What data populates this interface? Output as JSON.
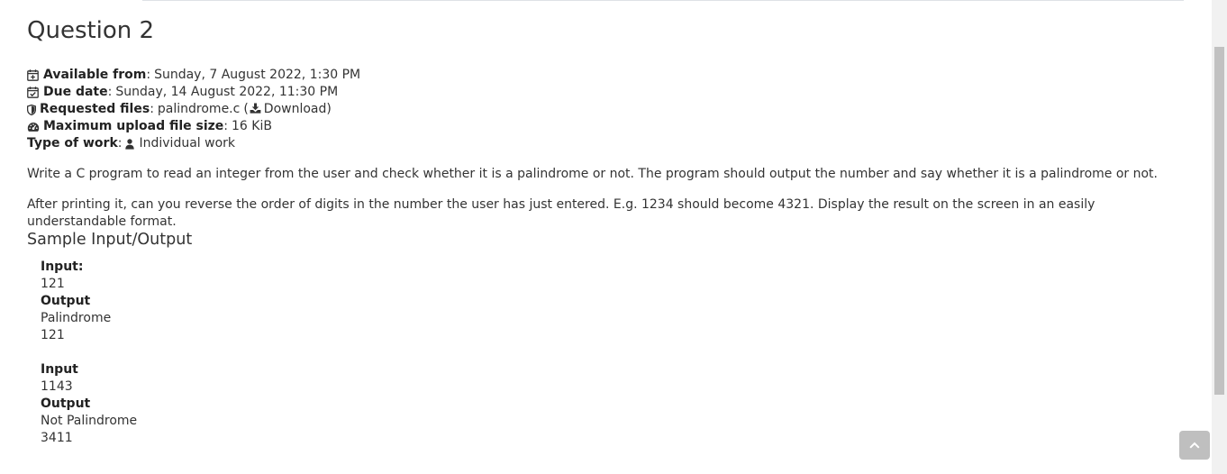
{
  "page_title": "Question 2",
  "meta": {
    "available_from_label": "Available from",
    "available_from_value": "Sunday, 7 August 2022, 1:30 PM",
    "due_date_label": "Due date",
    "due_date_value": "Sunday, 14 August 2022, 11:30 PM",
    "requested_files_label": "Requested files",
    "requested_files_value": "palindrome.c",
    "download_link": "Download",
    "max_upload_label": "Maximum upload file size",
    "max_upload_value": "16 KiB",
    "type_of_work_label": "Type of work",
    "type_of_work_value": "Individual work"
  },
  "description": {
    "paragraph1": "Write a C program to read an integer from the user and check whether it is a palindrome or not. The program should output the number and say whether it is a palindrome or not.",
    "paragraph2": "After printing it, can you reverse the order of digits in the number the user has just entered. E.g. 1234 should become 4321. Display the result on the screen in an easily understandable format."
  },
  "sample_heading": "Sample Input/Output",
  "samples": [
    {
      "input_label": "Input:",
      "input_value": "121",
      "output_label": "Output",
      "output_line1": "Palindrome",
      "output_line2": "121"
    },
    {
      "input_label": "Input",
      "input_value": "1143",
      "output_label": "Output",
      "output_line1": "Not Palindrome",
      "output_line2": "3411"
    }
  ],
  "icons": {
    "available_from": "calendar-plus-icon",
    "due_date": "calendar-check-icon",
    "requested_files": "shield-icon",
    "max_upload": "dashboard-icon",
    "download": "download-icon",
    "type_of_work": "user-icon",
    "back_to_top": "chevron-up-icon"
  },
  "colors": {
    "text": "#333333",
    "back_to_top_bg": "#bfbfbf",
    "scrollbar_thumb": "#c1c1c1"
  }
}
